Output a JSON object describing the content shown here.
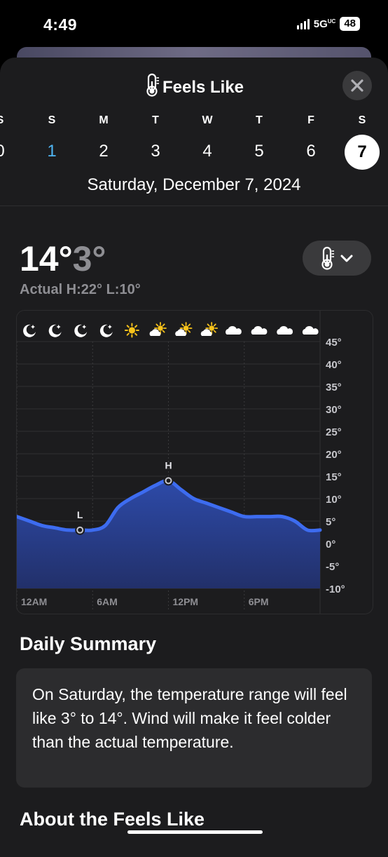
{
  "status": {
    "time": "4:49",
    "network": "5G",
    "network_sup": "UC",
    "battery": "48"
  },
  "header": {
    "title": "Feels Like",
    "icon": "thermometer-icon",
    "close_icon": "close-icon"
  },
  "week": {
    "days": [
      {
        "dow": "S",
        "date": "0"
      },
      {
        "dow": "S",
        "date": "1"
      },
      {
        "dow": "M",
        "date": "2"
      },
      {
        "dow": "T",
        "date": "3"
      },
      {
        "dow": "W",
        "date": "4"
      },
      {
        "dow": "T",
        "date": "5"
      },
      {
        "dow": "F",
        "date": "6"
      },
      {
        "dow": "S",
        "date": "7"
      }
    ],
    "today_index": 1,
    "selected_index": 7,
    "full_date": "Saturday, December 7, 2024"
  },
  "summary_temps": {
    "high": "14°",
    "low": "3°",
    "actual": "Actual H:22° L:10°"
  },
  "chart_data": {
    "type": "area",
    "x_labels": [
      "12AM",
      "6AM",
      "12PM",
      "6PM"
    ],
    "y_ticks": [
      "45°",
      "40°",
      "35°",
      "30°",
      "25°",
      "20°",
      "15°",
      "10°",
      "5°",
      "0°",
      "-5°",
      "-10°"
    ],
    "ylim": [
      -10,
      45
    ],
    "xlim": [
      0,
      24
    ],
    "hours": [
      0,
      1,
      2,
      3,
      4,
      5,
      6,
      7,
      8,
      9,
      10,
      11,
      12,
      13,
      14,
      15,
      16,
      17,
      18,
      19,
      20,
      21,
      22,
      23,
      24
    ],
    "values": [
      6,
      5,
      4,
      3.5,
      3,
      3,
      3,
      4,
      8,
      10,
      11.5,
      13,
      14,
      12,
      10,
      9,
      8,
      7,
      6,
      6,
      6,
      6,
      5,
      3,
      3
    ],
    "low_marker": {
      "hour": 5,
      "value": 3,
      "label": "L"
    },
    "high_marker": {
      "hour": 12,
      "value": 14,
      "label": "H"
    },
    "condition_icons": [
      "moon-icon",
      "moon-icon",
      "moon-icon",
      "moon-icon",
      "sun-icon",
      "partly-cloudy-icon",
      "partly-cloudy-icon",
      "partly-cloudy-icon",
      "cloud-icon",
      "cloud-icon",
      "cloud-icon",
      "cloud-icon"
    ],
    "colors": {
      "line": "#3d6cf0",
      "fill_top": "#2d4aa8",
      "fill_bottom": "#22306a",
      "grid": "#303032"
    }
  },
  "daily_summary": {
    "title": "Daily Summary",
    "text": "On Saturday, the temperature range will feel like 3° to 14°. Wind will make it feel colder than the actual temperature."
  },
  "about": {
    "title": "About the Feels Like"
  }
}
